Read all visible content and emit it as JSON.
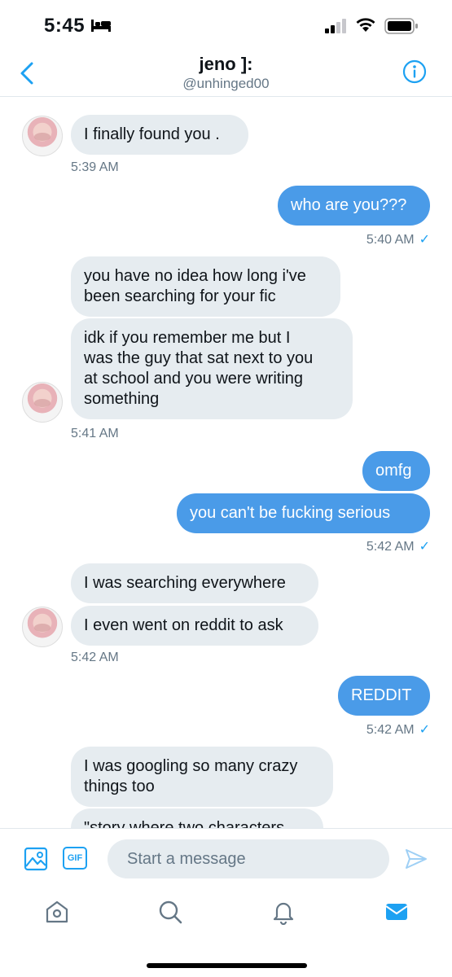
{
  "status_bar": {
    "time": "5:45"
  },
  "header": {
    "name": "jeno ]:",
    "handle": "@unhinged00"
  },
  "messages": [
    {
      "text": "I finally found you ."
    },
    {
      "time": "5:39 AM"
    },
    {
      "text": "who are you???"
    },
    {
      "time": "5:40 AM",
      "check": "✓"
    },
    {
      "text": "you have no idea how long i've\nbeen searching for your fic"
    },
    {
      "text": "idk if you remember me but I\nwas the guy that sat next to you\nat school and you were writing\nsomething"
    },
    {
      "time": "5:41 AM"
    },
    {
      "text": "omfg"
    },
    {
      "text": "you can't be fucking serious"
    },
    {
      "time": "5:42 AM",
      "check": "✓"
    },
    {
      "text": "I was searching everywhere"
    },
    {
      "text": "I even went on reddit to ask"
    },
    {
      "time": "5:42 AM"
    },
    {
      "text": "REDDIT"
    },
    {
      "time": "5:42 AM",
      "check": "✓"
    },
    {
      "text": "I was googling so many crazy\nthings too"
    },
    {
      "text": "\"story where two characters"
    }
  ],
  "composer": {
    "gif_label": "GIF",
    "placeholder": "Start a message"
  },
  "colors": {
    "accent": "#1da1f2",
    "outgoing_bubble": "#4a9be8",
    "incoming_bubble": "#e6ecf0"
  },
  "icons": [
    "back-chevron-icon",
    "info-icon",
    "image-icon",
    "gif-icon",
    "send-icon",
    "home-icon",
    "search-icon",
    "bell-icon",
    "mail-icon"
  ]
}
